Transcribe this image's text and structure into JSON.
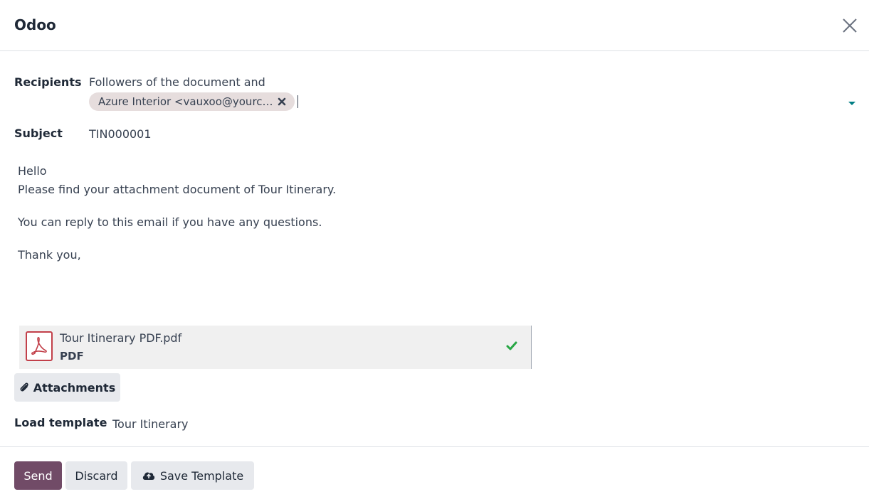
{
  "dialog": {
    "title": "Odoo"
  },
  "recipients": {
    "label": "Recipients",
    "text": "Followers of the document and",
    "tag": "Azure Interior <vauxoo@yourc…"
  },
  "subject": {
    "label": "Subject",
    "value": "TIN000001"
  },
  "body": {
    "lines": [
      "Hello",
      "Please find your attachment document of Tour Itinerary.",
      "You can reply to this email if you have any questions.",
      "Thank you,"
    ]
  },
  "attachment": {
    "name": "Tour Itinerary PDF.pdf",
    "type": "PDF",
    "icon": "pdf-file-icon",
    "status_icon": "check-icon"
  },
  "attachments_button": {
    "label": "Attachments",
    "icon": "paperclip-icon"
  },
  "template": {
    "label": "Load template",
    "value": "Tour Itinerary"
  },
  "footer": {
    "send_label": "Send",
    "discard_label": "Discard",
    "save_template_label": "Save Template",
    "save_icon": "cloud-upload-icon"
  },
  "colors": {
    "primary": "#714b67",
    "link": "#017e84",
    "success": "#28a745",
    "pdf": "#c2404a"
  }
}
